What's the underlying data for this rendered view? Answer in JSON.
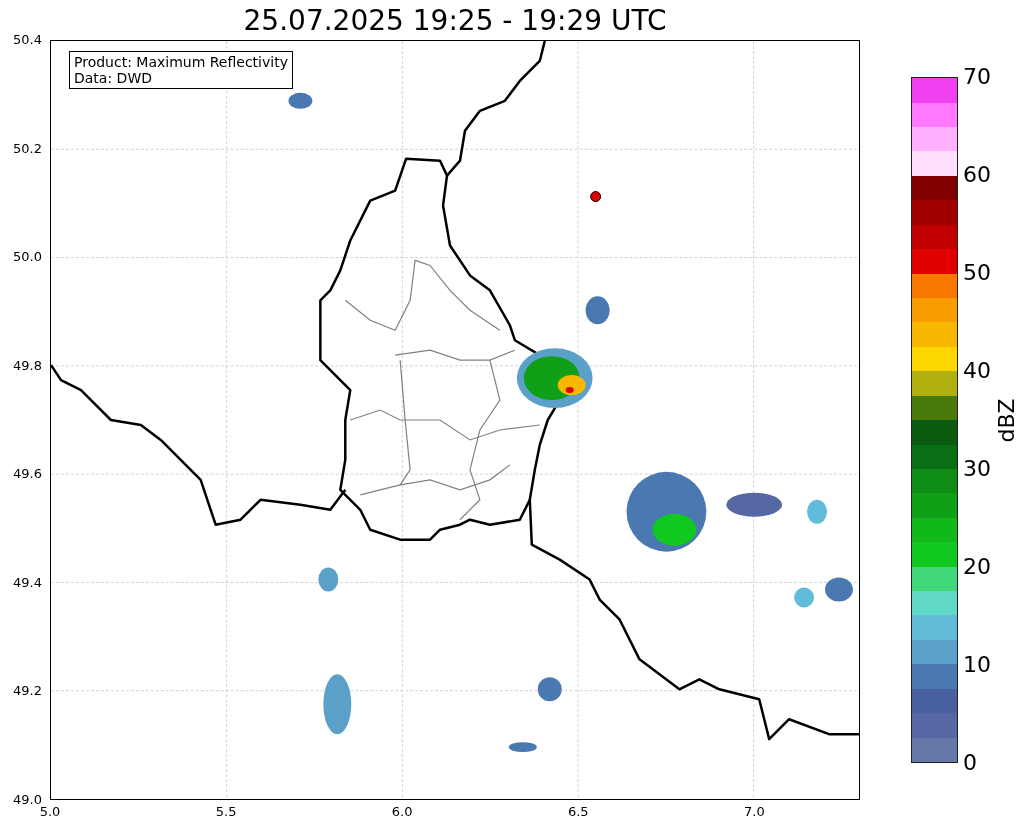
{
  "title": "25.07.2025 19:25 - 19:29 UTC",
  "map": {
    "annotation": [
      "Product: Maximum Reflectivity",
      "Data: DWD"
    ],
    "xticks": [
      "5.0",
      "5.5",
      "6.0",
      "6.5",
      "7.0"
    ],
    "yticks": [
      "50.4",
      "50.2",
      "50.0",
      "49.8",
      "49.6",
      "49.4",
      "49.2",
      "49.0"
    ]
  },
  "colorbar": {
    "label": "dBZ",
    "ticks": [
      "70",
      "60",
      "50",
      "40",
      "30",
      "20",
      "10",
      "0"
    ],
    "segments": [
      {
        "color": "#6478a8"
      },
      {
        "color": "#5568a4"
      },
      {
        "color": "#4860a0"
      },
      {
        "color": "#4a78b0"
      },
      {
        "color": "#5aa0c8"
      },
      {
        "color": "#60bcd8"
      },
      {
        "color": "#60d8c8"
      },
      {
        "color": "#40d878"
      },
      {
        "color": "#10c820"
      },
      {
        "color": "#10b818"
      },
      {
        "color": "#10a018"
      },
      {
        "color": "#0e8c14"
      },
      {
        "color": "#0a6e14"
      },
      {
        "color": "#0a5a10"
      },
      {
        "color": "#4a7a0a"
      },
      {
        "color": "#b0b010"
      },
      {
        "color": "#ffd700"
      },
      {
        "color": "#f8b800"
      },
      {
        "color": "#f89c00"
      },
      {
        "color": "#f87800"
      },
      {
        "color": "#e00000"
      },
      {
        "color": "#c00000"
      },
      {
        "color": "#a00000"
      },
      {
        "color": "#800000"
      },
      {
        "color": "#ffe0ff"
      },
      {
        "color": "#ffb0ff"
      },
      {
        "color": "#ff78ff"
      },
      {
        "color": "#f040f0"
      }
    ]
  }
}
